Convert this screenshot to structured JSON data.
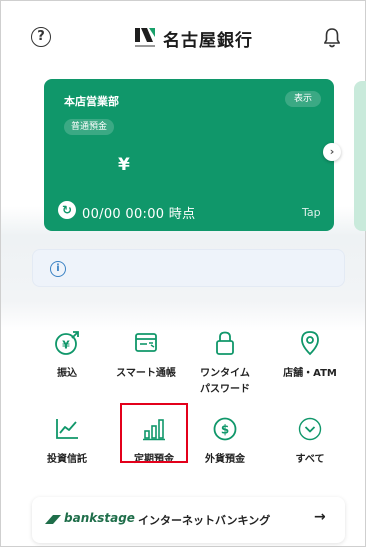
{
  "header": {
    "help_icon": "?",
    "bank_name": "名古屋銀行"
  },
  "account_card": {
    "branch": "本店営業部",
    "show_label": "表示",
    "account_type": "普通預金",
    "currency_symbol": "¥",
    "timestamp": "00/00 00:00 時点",
    "tap_label": "Tap",
    "card_color": "#10976a"
  },
  "notice": {
    "info_icon": "i",
    "text": ""
  },
  "menu": {
    "items": [
      {
        "label": "振込",
        "icon": "transfer-icon"
      },
      {
        "label": "スマート通帳",
        "icon": "passbook-icon"
      },
      {
        "label": "ワンタイム\nパスワード",
        "icon": "lock-icon"
      },
      {
        "label": "店舗・ATM",
        "icon": "location-icon"
      },
      {
        "label": "投資信託",
        "icon": "chart-line-icon"
      },
      {
        "label": "定期預金",
        "icon": "bar-chart-icon"
      },
      {
        "label": "外貨預金",
        "icon": "dollar-icon"
      },
      {
        "label": "すべて",
        "icon": "chevron-down-icon"
      }
    ],
    "icon_color": "#10976a",
    "highlight_color": "#e3001b"
  },
  "banner": {
    "brand": "bankstage",
    "label": "インターネットバンキング",
    "arrow": "→"
  }
}
